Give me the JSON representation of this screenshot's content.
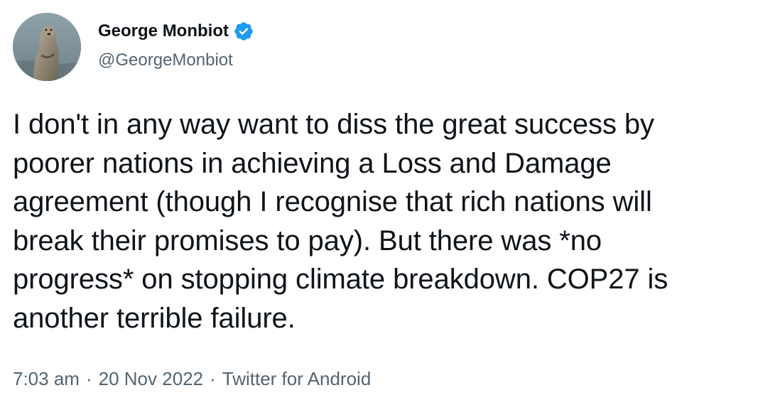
{
  "author": {
    "name": "George Monbiot",
    "handle": "@GeorgeMonbiot",
    "verified_icon": "verified-badge-icon",
    "verified_color": "#1d9bf0"
  },
  "tweet": {
    "lines": [
      "I don't in any way want to diss the great success by",
      "poorer nations in achieving a Loss and Damage",
      "agreement (though I recognise that rich nations will",
      "break their promises to pay). But there was *no",
      "progress* on stopping climate breakdown. COP27 is",
      "another terrible failure."
    ]
  },
  "meta": {
    "time": "7:03 am",
    "separator": "·",
    "date": "20 Nov 2022",
    "source": "Twitter for Android"
  },
  "colors": {
    "text": "#0f1419",
    "secondary": "#536471",
    "background": "#ffffff"
  }
}
